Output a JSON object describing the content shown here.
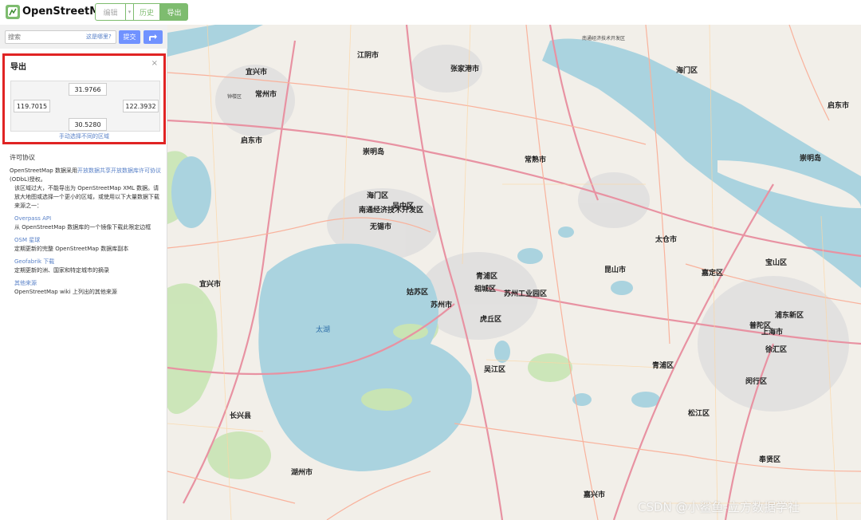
{
  "header": {
    "brand": "OpenStreetMap",
    "edit_label": "编辑",
    "history_label": "历史",
    "export_label": "导出"
  },
  "search": {
    "placeholder": "搜索",
    "where_link": "这是哪里?",
    "submit_label": "提交"
  },
  "export": {
    "title": "导出",
    "close": "×",
    "north": "31.9766",
    "west": "119.7015",
    "east": "122.3932",
    "south": "30.5280",
    "manual_link": "手动选择不同的区域"
  },
  "licence": {
    "heading": "许可协议",
    "text_before": "OpenStreetMap 数据采用",
    "odbl_link": "开放数据共享开放数据库许可协议",
    "text_after": " (ODbL)授权。",
    "warning": "该区域过大，不能导出为 OpenStreetMap XML 数据。请放大地图或选择一个更小的区域，或使用以下大量数据下载来源之一：",
    "sources": [
      {
        "title": "Overpass API",
        "desc": "从 OpenStreetMap 数据库的一个镜像下载此限定边框"
      },
      {
        "title": "OSM 星球",
        "desc": "定期更新的完整 OpenStreetMap 数据库副本"
      },
      {
        "title": "Geofabrik 下载",
        "desc": "定期更新的洲、国家和特定城市的摘录"
      },
      {
        "title": "其他来源",
        "desc": "OpenStreetMap wiki 上列出的其他来源"
      }
    ]
  },
  "map": {
    "cities": [
      "常州市",
      "江阴市",
      "张家港市",
      "常熟市",
      "无锡市",
      "苏州市",
      "昆山市",
      "太仓市",
      "上海市",
      "嘉定区",
      "宝山区",
      "吴江区",
      "湖州市",
      "嘉兴市",
      "长兴县",
      "宜兴市",
      "启东市",
      "崇明岛",
      "海门区",
      "南通经济技术开发区",
      "吴中区",
      "虎丘区",
      "姑苏区",
      "相城区",
      "青浦区",
      "松江区",
      "闵行区",
      "普陀区",
      "徐汇区",
      "浦东新区",
      "奉贤区",
      "新北区",
      "武进区",
      "惠山区",
      "梁溪区",
      "滨湖区",
      "新吴区",
      "苏州工业园区"
    ],
    "lake_label": "太湖",
    "watermark": "CSDN @小鲨鱼-立方数据学社",
    "colors": {
      "water": "#aad3df",
      "land": "#f2efe9",
      "motorway": "#e892a2",
      "trunk": "#f9b29c",
      "green": "#c8e4b4",
      "urban": "#e0dfdf"
    }
  }
}
